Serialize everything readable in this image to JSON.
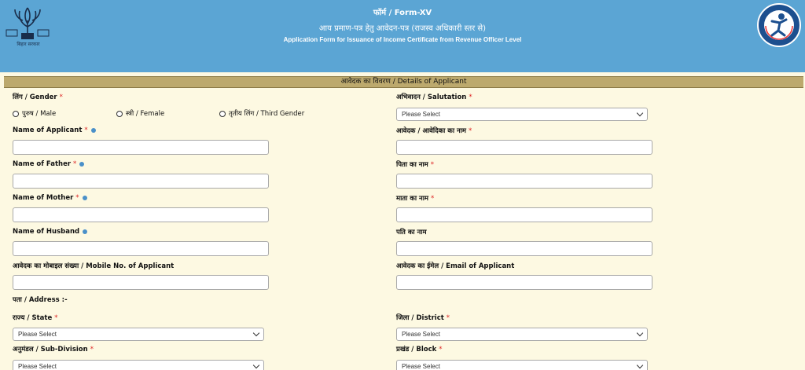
{
  "header": {
    "form_no": "फॉर्म / Form-XV",
    "title_hindi": "आय प्रमाण-पत्र हेतु आवेदन-पत्र (राजस्व अधिकारी स्तर से)",
    "title_english": "Application Form for Issuance of Income Certificate from Revenue Officer Level",
    "left_logo_caption": "बिहार सरकार"
  },
  "section": {
    "title": "आवेदक का विवरण / Details of Applicant"
  },
  "fields": {
    "gender_label": "लिंग / Gender",
    "gender_options": [
      "पुरुष / Male",
      "स्त्री / Female",
      "तृतीय लिंग / Third Gender"
    ],
    "salutation_label": "अभिवादन / Salutation",
    "salutation_value": "Please Select",
    "name_en_label": "Name of Applicant",
    "name_hi_label": "आवेदक / आवेदिका का नाम",
    "father_en_label": "Name of Father",
    "father_hi_label": "पिता का नाम",
    "mother_en_label": "Name of Mother",
    "mother_hi_label": "माता का नाम",
    "husband_en_label": "Name of Husband",
    "husband_hi_label": "पति का नाम",
    "mobile_label": "आवेदक का मोबाइल संख्या / Mobile No. of Applicant",
    "email_label": "आवेदक का ईमेल / Email of Applicant",
    "address_label": "पता / Address :-",
    "state_label": "राज्य / State",
    "state_value": "Please Select",
    "district_label": "जिला / District",
    "district_value": "Please Select",
    "subdivision_label": "अनुमंडल / Sub-Division",
    "subdivision_value": "Please Select",
    "block_label": "प्रखंड / Block",
    "block_value": "Please Select"
  },
  "required_mark": "*",
  "colors": {
    "header_bg": "#5ba5d4",
    "page_bg": "#fdf9e2",
    "section_bar": "#bca96d",
    "required": "#dd2222"
  }
}
